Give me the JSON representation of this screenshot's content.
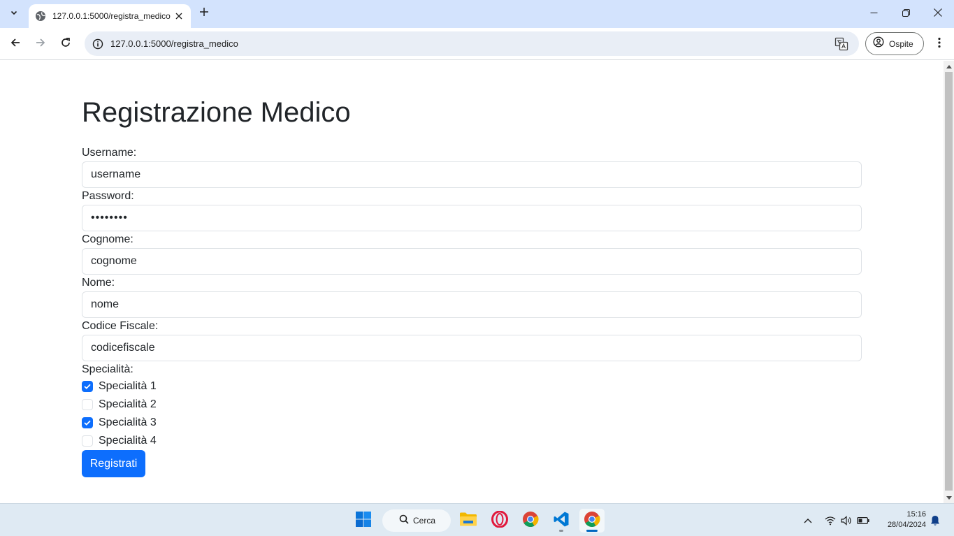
{
  "browser": {
    "tab": {
      "title": "127.0.0.1:5000/registra_medico"
    },
    "url": "127.0.0.1:5000/registra_medico",
    "profile_label": "Ospite"
  },
  "page": {
    "title": "Registrazione Medico",
    "fields": [
      {
        "label": "Username:",
        "value": "username",
        "type": "text"
      },
      {
        "label": "Password:",
        "value": "••••••••",
        "type": "password"
      },
      {
        "label": "Cognome:",
        "value": "cognome",
        "type": "text"
      },
      {
        "label": "Nome:",
        "value": "nome",
        "type": "text"
      },
      {
        "label": "Codice Fiscale:",
        "value": "codicefiscale",
        "type": "text"
      }
    ],
    "specialita_label": "Specialità:",
    "specialita": [
      {
        "label": "Specialità 1",
        "checked": true
      },
      {
        "label": "Specialità 2",
        "checked": false
      },
      {
        "label": "Specialità 3",
        "checked": true
      },
      {
        "label": "Specialità 4",
        "checked": false
      }
    ],
    "submit_label": "Registrati"
  },
  "taskbar": {
    "search_label": "Cerca",
    "time": "15:16",
    "date": "28/04/2024"
  },
  "colors": {
    "primary": "#0d6efd",
    "tabstrip_bg": "#d3e3fd",
    "omnibox_bg": "#e9eef6",
    "taskbar_bg": "#dfeaf3"
  }
}
